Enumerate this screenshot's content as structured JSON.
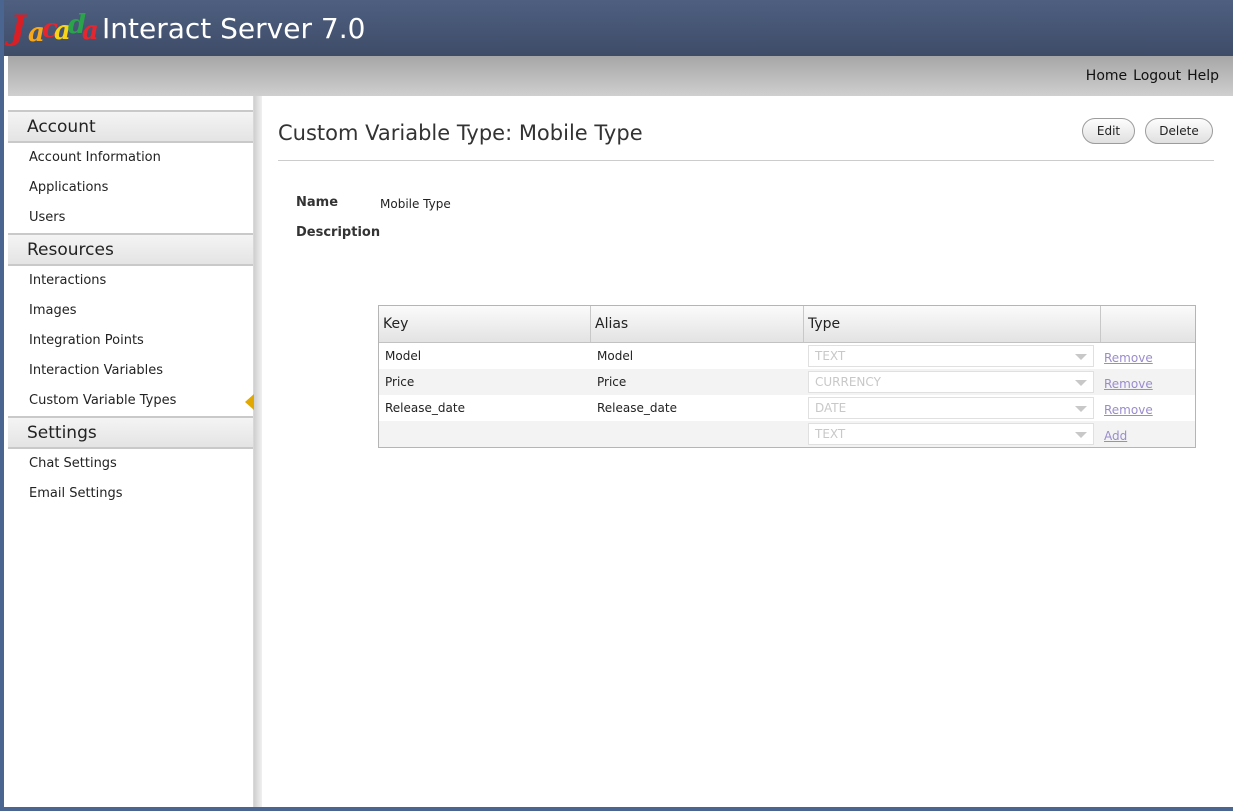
{
  "header": {
    "logo_text": "Jacada",
    "app_title": "Interact Server 7.0"
  },
  "topnav": [
    "Home",
    "Logout",
    "Help"
  ],
  "sidebar": {
    "sections": [
      {
        "title": "Account",
        "items": [
          "Account Information",
          "Applications",
          "Users"
        ]
      },
      {
        "title": "Resources",
        "items": [
          "Interactions",
          "Images",
          "Integration Points",
          "Interaction Variables",
          "Custom Variable Types"
        ]
      },
      {
        "title": "Settings",
        "items": [
          "Chat Settings",
          "Email Settings"
        ]
      }
    ],
    "active_item": "Custom Variable Types"
  },
  "main": {
    "page_title": "Custom Variable Type: Mobile Type",
    "edit_label": "Edit",
    "delete_label": "Delete",
    "name_label": "Name",
    "name_value": "Mobile Type",
    "description_label": "Description",
    "description_value": ""
  },
  "table": {
    "headers": [
      "Key",
      "Alias",
      "Type",
      ""
    ],
    "rows": [
      {
        "key": "Model",
        "alias": "Model",
        "type": "TEXT",
        "action": "Remove"
      },
      {
        "key": "Price",
        "alias": "Price",
        "type": "CURRENCY",
        "action": "Remove"
      },
      {
        "key": "Release_date",
        "alias": "Release_date",
        "type": "DATE",
        "action": "Remove"
      },
      {
        "key": "",
        "alias": "",
        "type": "TEXT",
        "action": "Add"
      }
    ]
  },
  "colors": {
    "header_bg": "#4e5f80",
    "active_marker": "#e0a800",
    "link": "#9a8ccc"
  }
}
